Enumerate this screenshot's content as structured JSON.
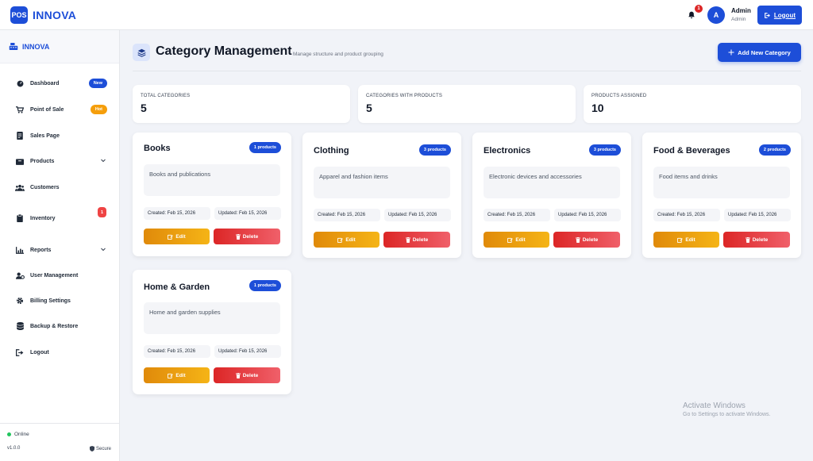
{
  "topbar": {
    "logo_text": "POS",
    "brand_name": "INNOVA",
    "notification_count": "1",
    "avatar_initial": "A",
    "user_name": "Admin",
    "user_role": "Admin",
    "logout_label": "Logout"
  },
  "sidebar": {
    "brand_name": "INNOVA",
    "items": [
      {
        "label": "Dashboard",
        "icon": "dashboard-icon",
        "badge": "New",
        "badge_color": "#1d4ed8"
      },
      {
        "label": "Point of Sale",
        "icon": "cart-icon",
        "badge": "Hot",
        "badge_color": "#f59e0b"
      },
      {
        "label": "Sales Page",
        "icon": "receipt-icon"
      },
      {
        "label": "Products",
        "icon": "box-icon",
        "expandable": true
      },
      {
        "label": "Customers",
        "icon": "users-icon"
      },
      {
        "label": "Inventory",
        "icon": "clipboard-icon",
        "badge": "1",
        "badge_color": "#ef4444"
      },
      {
        "label": "Reports",
        "icon": "chart-icon",
        "expandable": true
      },
      {
        "label": "User Management",
        "icon": "user-cog-icon"
      },
      {
        "label": "Billing Settings",
        "icon": "gear-icon"
      },
      {
        "label": "Backup & Restore",
        "icon": "database-icon"
      },
      {
        "label": "Logout",
        "icon": "sign-out-icon"
      }
    ],
    "footer": {
      "status": "Online",
      "version": "v1.0.0",
      "secure": "Secure"
    }
  },
  "header": {
    "title": "Category Management",
    "subtitle": "Manage structure and product grouping",
    "add_button": "Add New Category"
  },
  "stats": [
    {
      "label": "TOTAL CATEGORIES",
      "value": "5"
    },
    {
      "label": "CATEGORIES WITH PRODUCTS",
      "value": "5"
    },
    {
      "label": "PRODUCTS ASSIGNED",
      "value": "10"
    }
  ],
  "categories": [
    {
      "name": "Books",
      "count": "1 products",
      "description": "Books and publications",
      "created": "Created: Feb 15, 2026",
      "updated": "Updated: Feb 15, 2026"
    },
    {
      "name": "Clothing",
      "count": "3 products",
      "description": "Apparel and fashion items",
      "created": "Created: Feb 15, 2026",
      "updated": "Updated: Feb 15, 2026"
    },
    {
      "name": "Electronics",
      "count": "3 products",
      "description": "Electronic devices and accessories",
      "created": "Created: Feb 15, 2026",
      "updated": "Updated: Feb 15, 2026"
    },
    {
      "name": "Food & Beverages",
      "count": "2 products",
      "description": "Food items and drinks",
      "created": "Created: Feb 15, 2026",
      "updated": "Updated: Feb 15, 2026"
    },
    {
      "name": "Home & Garden",
      "count": "1 products",
      "description": "Home and garden supplies",
      "created": "Created: Feb 15, 2026",
      "updated": "Updated: Feb 15, 2026"
    }
  ],
  "card_actions": {
    "edit": "Edit",
    "delete": "Delete"
  },
  "watermark": {
    "line1": "Activate Windows",
    "line2": "Go to Settings to activate Windows."
  }
}
